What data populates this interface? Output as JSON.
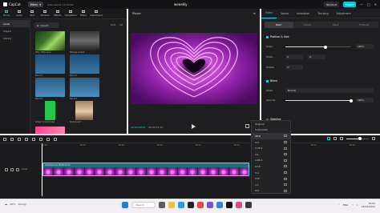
{
  "titlebar": {
    "app_name": "CapCut",
    "menu_label": "Menu",
    "autosave": "Auto saved: 19:52:02",
    "project_title": "weeekly",
    "shortcut_label": "Shortcut",
    "export_label": "Export"
  },
  "media": {
    "tabs": [
      {
        "label": "Media",
        "icon": "media-icon"
      },
      {
        "label": "Audio",
        "icon": "audio-icon"
      },
      {
        "label": "Text",
        "icon": "text-icon"
      },
      {
        "label": "Stickers",
        "icon": "sticker-icon"
      },
      {
        "label": "Effects",
        "icon": "effects-icon"
      },
      {
        "label": "Transitions",
        "icon": "transitions-icon"
      },
      {
        "label": "Filters",
        "icon": "filters-icon"
      },
      {
        "label": "Adjustment",
        "icon": "adjust-icon"
      }
    ],
    "side_items": [
      "Local",
      "Import",
      "Library"
    ],
    "import_label": "Import",
    "sort_label": "Sort",
    "all_label": "All",
    "thumbs": [
      {
        "label": "IMG_7840.mp4"
      },
      {
        "label": "ffmpeg-2.mp4"
      },
      {
        "label": "Record"
      },
      {
        "label": "Record"
      },
      {
        "label": "Record"
      },
      {
        "label": "Record"
      },
      {
        "label": "Green Screen.mp4"
      },
      {
        "label": "Bodyguard ..."
      }
    ]
  },
  "player": {
    "label": "Player",
    "time_current": "00:00:00:00",
    "time_total": "00:00:14:12"
  },
  "props": {
    "tabs": [
      "Video",
      "Speed",
      "Animation",
      "Tracking",
      "Adjustment"
    ],
    "subtabs": [
      "Basic",
      "Cutout",
      "Mask",
      "Enhance"
    ],
    "position_size": "Position & Size",
    "scale_label": "Scale",
    "scale_value": "100%",
    "position_label": "Positi...",
    "position_x": "0",
    "position_y": "0",
    "rotate_label": "Rotate",
    "rotate_value": "0°",
    "blend": "Blend",
    "mode_label": "Mode",
    "mode_value": "Normal",
    "opacity_label": "Opacity",
    "opacity_value": "100%",
    "stabilize": "Stabilize"
  },
  "dropdown": {
    "items": [
      "Original",
      "Customize",
      "16:9",
      "4:3",
      "2.35:1",
      "2:1",
      "1.85:1",
      "9:16",
      "3:4",
      "5.8\"",
      "1:1",
      "4:5"
    ],
    "selected_index": 2
  },
  "timeline": {
    "clip_label": "trimmed.mov  00:00:14:12",
    "ruler_ticks": [
      "00:00",
      "00:03",
      "00:06",
      "00:09",
      "00:12",
      "00:15",
      "00:18",
      "00:21",
      "00:24"
    ],
    "cover_label": "Cover"
  },
  "taskbar": {
    "weather_temp": "18°C",
    "weather_desc": "Cloudy",
    "search_label": "Search",
    "lang": "ENG",
    "time": "19:52",
    "date": "16/12/2022"
  },
  "colors": {
    "accent": "#19d3de",
    "export": "#0ec6d6",
    "panel": "#1e1e20",
    "stage": "#6a0f8a"
  }
}
